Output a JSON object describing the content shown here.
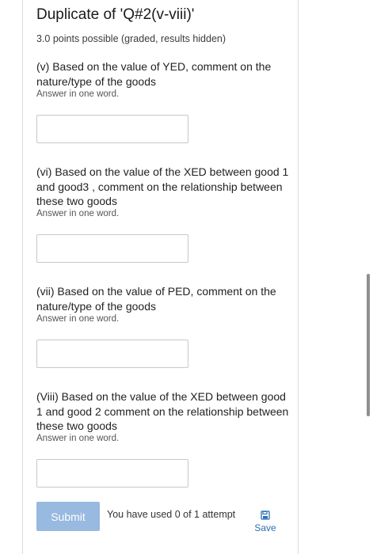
{
  "header": {
    "title": "Duplicate of 'Q#2(v-viii)'",
    "points": "3.0 points possible (graded, results hidden)"
  },
  "questions": [
    {
      "text": "(v) Based on the value of YED, comment on the nature/type of the goods",
      "hint": "Answer in one word.",
      "answer_value": ""
    },
    {
      "text": "(vi) Based on the value of the XED between good 1 and good3 , comment on the relationship between these two goods",
      "hint": "Answer in one word.",
      "answer_value": ""
    },
    {
      "text": "(vii) Based on the value of PED, comment on the nature/type of the goods",
      "hint": "Answer in one word.",
      "answer_value": ""
    },
    {
      "text": "(Viii) Based on the value of the XED between good 1 and good 2 comment on the relationship between these two goods",
      "hint": "Answer in one word.",
      "answer_value": ""
    }
  ],
  "footer": {
    "submit_label": "Submit",
    "attempts_text": "You have used 0 of 1 attempt",
    "save_label": "Save",
    "save_icon": "save-icon"
  },
  "colors": {
    "submit_bg": "#98b9e0",
    "link": "#2a6fb8"
  }
}
